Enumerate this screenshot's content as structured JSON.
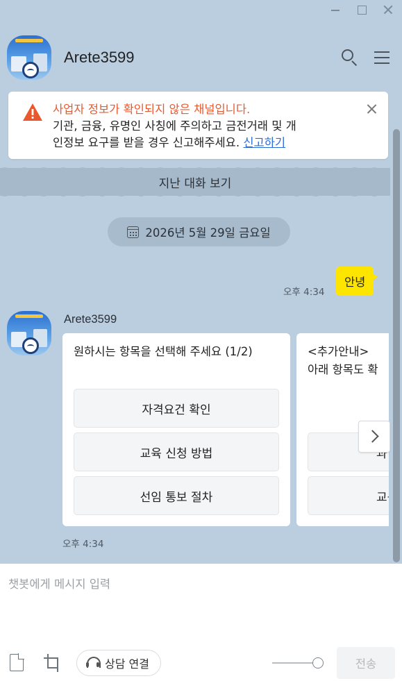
{
  "window": {
    "controls": [
      "minimize-icon",
      "maximize-icon",
      "close-icon"
    ]
  },
  "header": {
    "title": "Arete3599",
    "icons": [
      "search-icon",
      "menu-icon"
    ]
  },
  "notice": {
    "line1": "사업자 정보가 확인되지 않은 채널입니다.",
    "line2": "기관, 금융, 유명인 사칭에 주의하고 금전거래 및 개",
    "line3": "인정보 요구를 받을 경우 신고해주세요.",
    "report_link": "신고하기",
    "color_warning": "#e8592e"
  },
  "history": {
    "label": "지난 대화 보기"
  },
  "date_divider": {
    "label": "2026년 5월 29일 금요일"
  },
  "my_message": {
    "time": "오후 4:34",
    "text": "안녕",
    "bubble_color": "#fee500"
  },
  "bot_message": {
    "sender": "Arete3599",
    "time": "오후 4:34",
    "cards": [
      {
        "description": "원하시는 항목을 선택해 주세요 (1/2)",
        "options": [
          "자격요건 확인",
          "교육 신청 방법",
          "선임 통보 절차"
        ]
      },
      {
        "title": "<추가안내>",
        "description": "아래 항목도 확",
        "options": [
          "",
          "과",
          "교육"
        ]
      }
    ]
  },
  "composer": {
    "placeholder": "챗봇에게 메시지 입력",
    "value": "",
    "consult_label": "상담 연결",
    "send_label": "전송",
    "toolbar_icons": [
      "file-icon",
      "crop-icon",
      "headset-icon"
    ]
  }
}
